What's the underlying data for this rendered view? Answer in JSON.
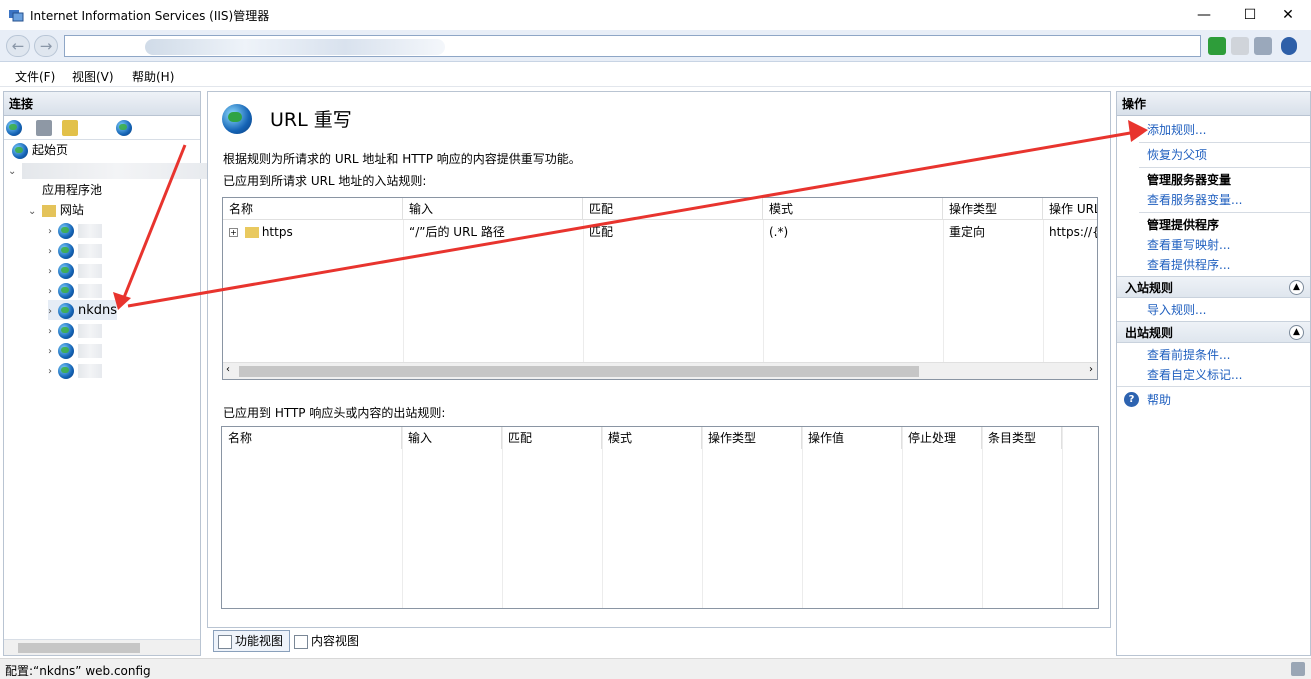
{
  "window": {
    "title": "Internet Information Services (IIS)管理器",
    "controls": {
      "minimize": "—",
      "maximize": "☐",
      "close": "✕"
    }
  },
  "menu": [
    "文件(F)",
    "视图(V)",
    "帮助(H)"
  ],
  "connections": {
    "header": "连接",
    "tree": {
      "start_page": "起始页",
      "app_pools": "应用程序池",
      "sites_label": "网站",
      "selected_site": "nkdns"
    }
  },
  "feature": {
    "title": "URL 重写",
    "description": "根据规则为所请求的 URL 地址和 HTTP 响应的内容提供重写功能。",
    "inbound_label": "已应用到所请求 URL 地址的入站规则:",
    "inbound_columns": [
      "名称",
      "输入",
      "匹配",
      "模式",
      "操作类型",
      "操作 URL"
    ],
    "inbound_rules": [
      {
        "name": "https",
        "input": "“/”后的 URL 路径",
        "match": "匹配",
        "pattern": "(.*)",
        "action_type": "重定向",
        "action_url": "https://{H"
      }
    ],
    "outbound_label": "已应用到 HTTP 响应头或内容的出站规则:",
    "outbound_columns": [
      "名称",
      "输入",
      "匹配",
      "模式",
      "操作类型",
      "操作值",
      "停止处理",
      "条目类型"
    ]
  },
  "view_tabs": [
    "功能视图",
    "内容视图"
  ],
  "actions": {
    "header": "操作",
    "add_rule": "添加规则...",
    "revert_to_parent": "恢复为父项",
    "manage_server_variables": "管理服务器变量",
    "view_server_variables": "查看服务器变量...",
    "manage_providers": "管理提供程序",
    "view_rewrite_maps": "查看重写映射...",
    "view_providers": "查看提供程序...",
    "inbound_rules_section": "入站规则",
    "import_rules": "导入规则...",
    "outbound_rules_section": "出站规则",
    "view_preconditions": "查看前提条件...",
    "view_custom_tags": "查看自定义标记...",
    "help": "帮助"
  },
  "status": "配置:“nkdns” web.config",
  "colors": {
    "link": "#1f5fbf",
    "annotation_arrow": "#e8342e"
  }
}
